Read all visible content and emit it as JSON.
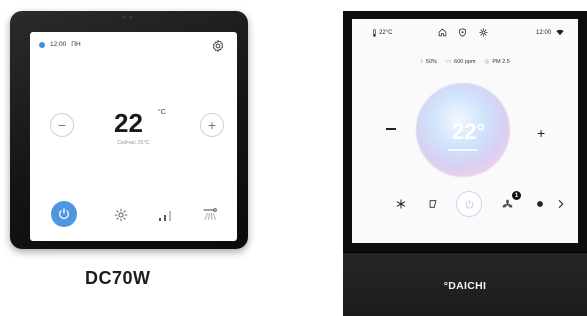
{
  "product1": {
    "model_label": "DC70W",
    "status": {
      "time": "12:00",
      "day": "ПН"
    },
    "temperature": {
      "value": "22",
      "unit": "°C"
    },
    "current_temp_text": "Сейчас 25°C",
    "controls": {
      "decrease": "−",
      "increase": "+"
    },
    "icons": [
      "settings-icon",
      "power-icon",
      "sun-mode-icon",
      "fan-speed-icon",
      "swing-icon"
    ],
    "colors": {
      "accent": "#4e96e2",
      "bezel": "#141414",
      "screen": "#ffffff"
    }
  },
  "product2": {
    "brand": "°DAICHI",
    "status": {
      "temp": "22°C",
      "time": "12:00"
    },
    "sensors": [
      {
        "icon": "humidity-icon",
        "value": "50%"
      },
      {
        "icon": "co2-icon",
        "value": "600 ppm"
      },
      {
        "icon": "pm-icon",
        "value": "PM 2.5"
      }
    ],
    "temperature": {
      "value": "22°"
    },
    "controls": {
      "decrease": "−",
      "increase": "+"
    },
    "badge_count": "1",
    "icons": [
      "thermometer-icon",
      "home-icon",
      "shield-icon",
      "settings-icon",
      "wifi-icon",
      "snowflake-icon",
      "filter-icon",
      "power-icon",
      "fan-icon",
      "sun-icon",
      "more-icon"
    ],
    "colors": {
      "orb_blue": "#cfe3fb",
      "orb_pink": "#f3d1e6",
      "bezel": "#0d0d0d"
    }
  }
}
